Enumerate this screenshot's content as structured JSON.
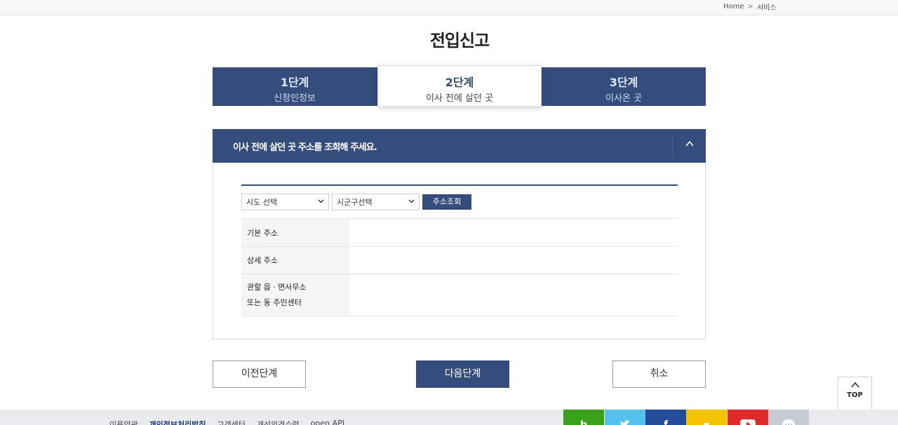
{
  "breadcrumb": {
    "home": "Home",
    "separator": ">",
    "current": "서비스"
  },
  "page_title": "전입신고",
  "steps": [
    {
      "num": "1단계",
      "desc": "신청인정보"
    },
    {
      "num": "2단계",
      "desc": "이사 전에 살던 곳"
    },
    {
      "num": "3단계",
      "desc": "이사온 곳"
    }
  ],
  "active_step": 2,
  "panel": {
    "title": "이사 전에 살던 곳 주소를 조회해 주세요.",
    "toggle_icon": "chevron-up-icon",
    "sido_select": "시도 선택",
    "sigungu_select": "시군구선택",
    "search_button": "주소조회",
    "rows": {
      "basic_label": "기본 주소",
      "basic_value": "",
      "detail_label": "상세 주소",
      "detail_value": "",
      "office_label_line1": "관할 읍ㆍ면사무소",
      "office_label_line2": "또는 동 주민센터",
      "office_value": ""
    }
  },
  "buttons": {
    "prev": "이전단계",
    "next": "다음단계",
    "cancel": "취소"
  },
  "top_button": {
    "label": "TOP",
    "icon": "arrow-up-icon"
  },
  "footer": {
    "links": [
      "이용약관",
      "개인정보처리방침",
      "고객센터",
      "개선의견수렴",
      "open API"
    ]
  },
  "social_icons": [
    "blog-icon",
    "twitter-icon",
    "facebook-icon",
    "kakaostory-icon",
    "youtube-icon",
    "kakaotalk-icon"
  ],
  "colors": {
    "primary": "#344d7c",
    "background": "#ffffff"
  }
}
